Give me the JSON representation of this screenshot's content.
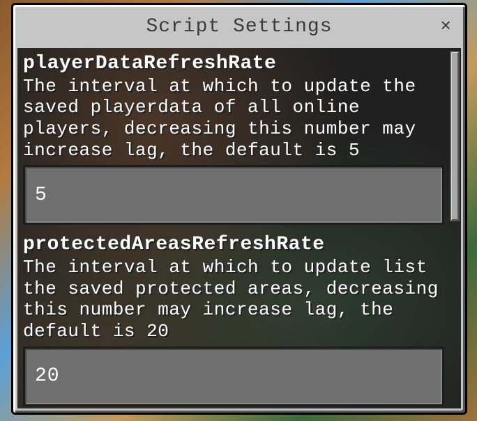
{
  "window": {
    "title": "Script Settings",
    "close_glyph": "×"
  },
  "settings": [
    {
      "name": "playerDataRefreshRate",
      "description": "The interval at which to update the saved playerdata of all online players, decreasing this number may increase lag, the default is 5",
      "value": "5"
    },
    {
      "name": "protectedAreasRefreshRate",
      "description": "The interval at which to update list the saved protected areas, decreasing this number may increase lag, the default is 20",
      "value": "20"
    }
  ]
}
